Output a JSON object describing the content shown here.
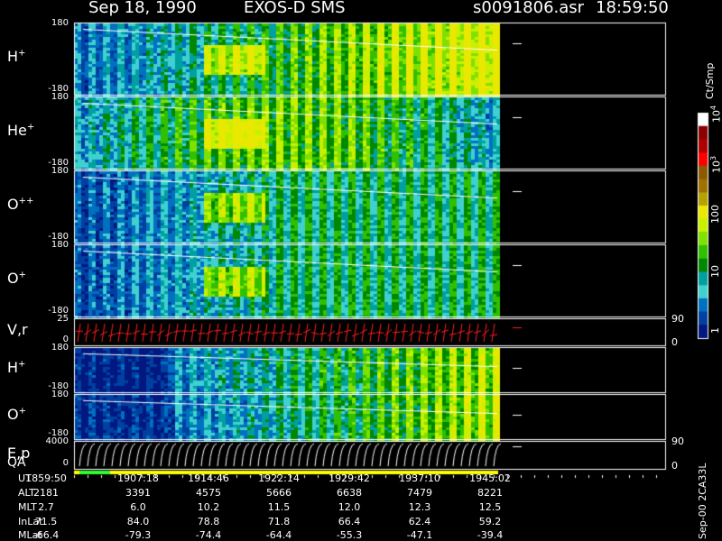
{
  "header": {
    "date": "Sep 18, 1990",
    "mission": "EXOS-D SMS",
    "file": "s0091806.asr",
    "time": "18:59:50"
  },
  "panels": [
    {
      "label": "H",
      "sup": "+",
      "top_tick": "180",
      "bottom_tick": "-180"
    },
    {
      "label": "He",
      "sup": "+",
      "top_tick": "180",
      "bottom_tick": "-180"
    },
    {
      "label": "O",
      "sup": "++",
      "top_tick": "180",
      "bottom_tick": "-180"
    },
    {
      "label": "O",
      "sup": "+",
      "top_tick": "180",
      "bottom_tick": "-180"
    },
    {
      "label": "V,r",
      "sup": "",
      "top_tick": "25",
      "bottom_tick": "0",
      "right_top": "90",
      "right_bottom": "0"
    },
    {
      "label": "H",
      "sup": "+",
      "top_tick": "180",
      "bottom_tick": "-180"
    },
    {
      "label": "O",
      "sup": "+",
      "top_tick": "180",
      "bottom_tick": "-180"
    },
    {
      "label": "E,p",
      "sup": "",
      "top_tick": "4000",
      "bottom_tick": "0",
      "right_top": "90",
      "right_bottom": "0"
    }
  ],
  "qa_label": "QA",
  "colorbar": {
    "unit": "Ct/Smp",
    "ticks": [
      "10",
      "10",
      "100",
      "10",
      "1"
    ],
    "tick_sups": [
      "4",
      "3",
      "",
      "",
      ""
    ],
    "colors": [
      "#ffffff",
      "#8b0000",
      "#b00000",
      "#ff0000",
      "#8b5a00",
      "#a07000",
      "#b8a000",
      "#e8e800",
      "#c8f000",
      "#80e000",
      "#30c000",
      "#008800",
      "#00a0a0",
      "#40d0d0",
      "#0070c0",
      "#0040a0",
      "#001880"
    ]
  },
  "ephemeris": {
    "labels": [
      "UT",
      "ALT",
      "MLT",
      "InLat",
      "MLat"
    ],
    "columns": [
      [
        "1859:50",
        "2181",
        "2.7",
        "71.5",
        "-66.4"
      ],
      [
        "1907:18",
        "3391",
        "6.0",
        "84.0",
        "-79.3"
      ],
      [
        "1914:46",
        "4575",
        "10.2",
        "78.8",
        "-74.4"
      ],
      [
        "1922:14",
        "5666",
        "11.5",
        "71.8",
        "-64.4"
      ],
      [
        "1929:42",
        "6638",
        "12.0",
        "66.4",
        "-55.3"
      ],
      [
        "1937:10",
        "7479",
        "12.3",
        "62.4",
        "-47.1"
      ],
      [
        "1945:02",
        "8221",
        "12.5",
        "59.2",
        "-39.4"
      ]
    ]
  },
  "footer": "Sep-00 2CA33L",
  "chart_data": {
    "type": "heatmap",
    "title": "Sep 18, 1990   EXOS-D SMS",
    "x": [
      "1859:50",
      "1907:18",
      "1914:46",
      "1922:14",
      "1929:42",
      "1937:10",
      "1945:02"
    ],
    "xlabel": "UT",
    "series": [
      {
        "name": "H+",
        "ylim": [
          -180,
          180
        ],
        "intensity_trend": "low-to-high"
      },
      {
        "name": "He+",
        "ylim": [
          -180,
          180
        ],
        "intensity_trend": "moderate"
      },
      {
        "name": "O++",
        "ylim": [
          -180,
          180
        ],
        "intensity_trend": "moderate"
      },
      {
        "name": "O+",
        "ylim": [
          -180,
          180
        ],
        "intensity_trend": "moderate"
      },
      {
        "name": "V,r",
        "ylim": [
          0,
          25
        ],
        "right_ylim": [
          0,
          90
        ]
      },
      {
        "name": "H+",
        "ylim": [
          -180,
          180
        ],
        "intensity_trend": "low-to-high"
      },
      {
        "name": "O+",
        "ylim": [
          -180,
          180
        ],
        "intensity_trend": "low-to-high"
      },
      {
        "name": "E,p",
        "ylim": [
          0,
          4000
        ],
        "right_ylim": [
          0,
          90
        ]
      }
    ],
    "color_scale": {
      "type": "log",
      "range": [
        1,
        10000
      ],
      "unit": "Ct/Smp"
    }
  }
}
